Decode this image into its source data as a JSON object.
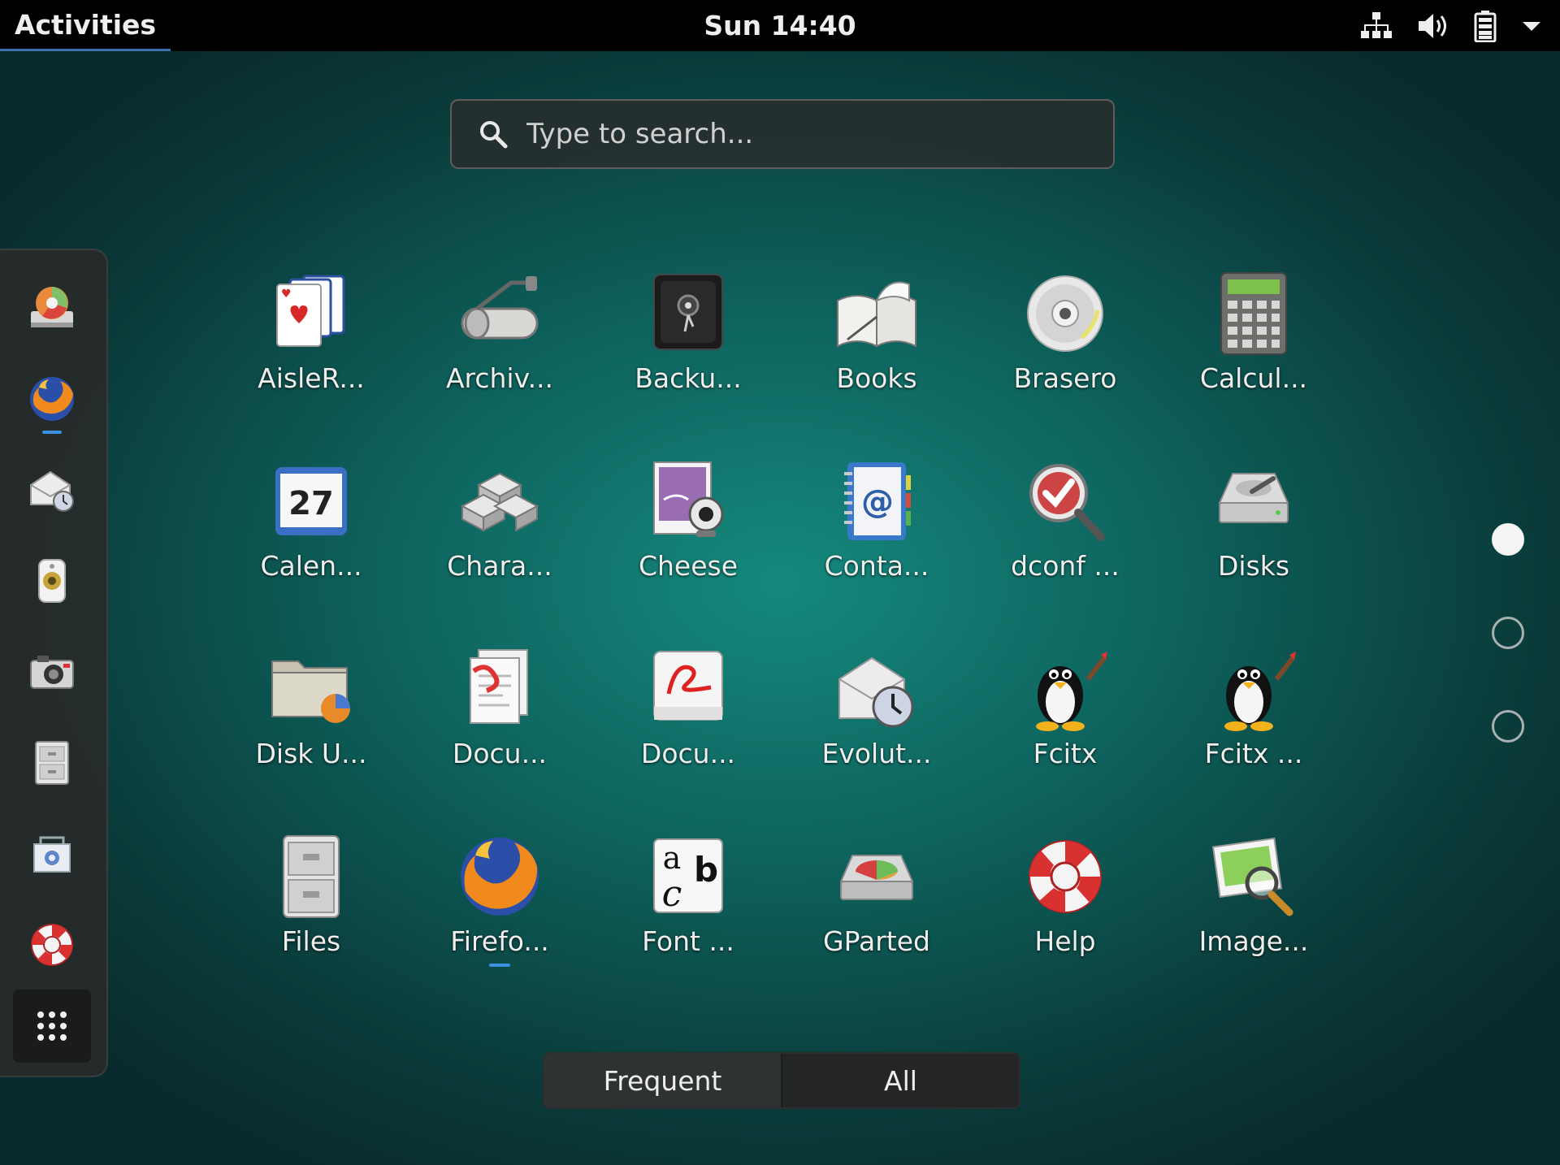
{
  "topbar": {
    "activities_label": "Activities",
    "clock": "Sun 14:40",
    "tray_icons": [
      "network-wired-icon",
      "volume-icon",
      "battery-icon",
      "system-menu-arrow-icon"
    ]
  },
  "search": {
    "placeholder": "Type to search..."
  },
  "dash": {
    "items": [
      {
        "icon": "disk-usage-analyzer-icon"
      },
      {
        "icon": "firefox-icon",
        "running": true
      },
      {
        "icon": "evolution-mail-icon"
      },
      {
        "icon": "rhythmbox-speaker-icon"
      },
      {
        "icon": "camera-icon"
      },
      {
        "icon": "files-cabinet-icon"
      },
      {
        "icon": "software-install-icon"
      },
      {
        "icon": "help-lifebuoy-icon"
      },
      {
        "icon": "show-applications-grid-icon",
        "active": true
      }
    ]
  },
  "apps": [
    {
      "label": "AisleR...",
      "icon": "aisleriot-cards-icon"
    },
    {
      "label": "Archiv...",
      "icon": "archive-manager-icon"
    },
    {
      "label": "Backu...",
      "icon": "backup-safe-icon"
    },
    {
      "label": "Books",
      "icon": "books-icon"
    },
    {
      "label": "Brasero",
      "icon": "brasero-disc-icon"
    },
    {
      "label": "Calcul...",
      "icon": "calculator-icon"
    },
    {
      "label": "Calen...",
      "icon": "calendar-icon",
      "day": "27"
    },
    {
      "label": "Chara...",
      "icon": "characters-icon"
    },
    {
      "label": "Cheese",
      "icon": "cheese-webcam-icon"
    },
    {
      "label": "Conta...",
      "icon": "contacts-icon"
    },
    {
      "label": "dconf ...",
      "icon": "dconf-editor-icon"
    },
    {
      "label": "Disks",
      "icon": "disks-icon"
    },
    {
      "label": "Disk U...",
      "icon": "disk-usage-icon"
    },
    {
      "label": "Docu...",
      "icon": "document-viewer-icon"
    },
    {
      "label": "Docu...",
      "icon": "document-scanner-icon"
    },
    {
      "label": "Evolut...",
      "icon": "evolution-icon"
    },
    {
      "label": "Fcitx",
      "icon": "fcitx-tux-icon"
    },
    {
      "label": "Fcitx ...",
      "icon": "fcitx-config-tux-icon"
    },
    {
      "label": "Files",
      "icon": "files-icon"
    },
    {
      "label": "Firefo...",
      "icon": "firefox-icon",
      "running": true
    },
    {
      "label": "Font ...",
      "icon": "font-viewer-icon",
      "glyphs": [
        "a",
        "b",
        "c"
      ]
    },
    {
      "label": "GParted",
      "icon": "gparted-icon"
    },
    {
      "label": "Help",
      "icon": "help-icon"
    },
    {
      "label": "Image...",
      "icon": "image-viewer-icon"
    }
  ],
  "pager": {
    "pages": 3,
    "current": 1
  },
  "view_toggle": {
    "frequent_label": "Frequent",
    "all_label": "All",
    "selected": "All"
  },
  "colors": {
    "accent": "#3d8fe0",
    "panel": "#000000",
    "bg_center": "#15897e"
  }
}
